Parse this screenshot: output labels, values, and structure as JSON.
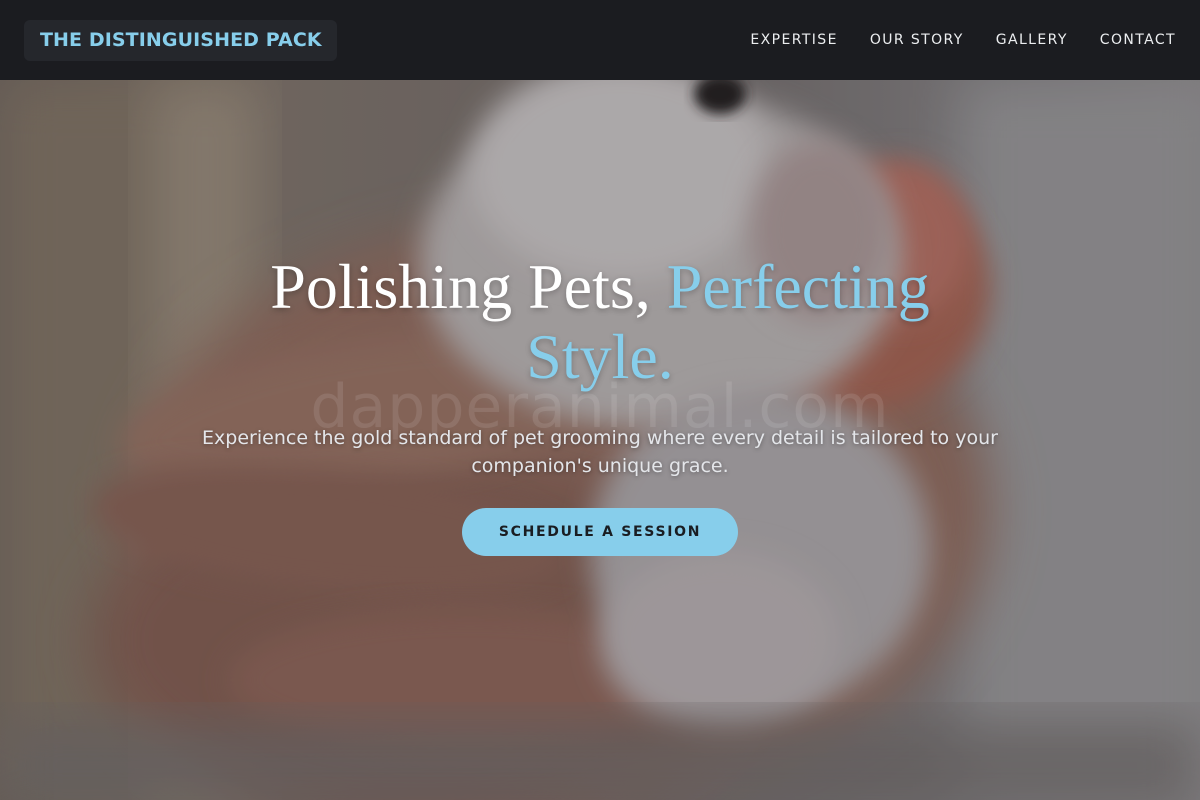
{
  "header": {
    "brand": "THE DISTINGUISHED PACK",
    "nav": [
      {
        "label": "EXPERTISE"
      },
      {
        "label": "OUR STORY"
      },
      {
        "label": "GALLERY"
      },
      {
        "label": "CONTACT"
      }
    ]
  },
  "hero": {
    "headline_part1": "Polishing Pets, ",
    "headline_accent": "Perfecting Style.",
    "watermark": "dapperanimal.com",
    "subtitle": "Experience the gold standard of pet grooming where every detail is tailored to your companion's unique grace.",
    "cta_label": "SCHEDULE A SESSION",
    "photo_alt": "Close-up of a hand holding a small white furry pet"
  },
  "colors": {
    "accent": "#87ceeb",
    "navbar_bg": "#1b1c20",
    "brand_bg": "#25272c",
    "text_light": "#ffffff"
  }
}
